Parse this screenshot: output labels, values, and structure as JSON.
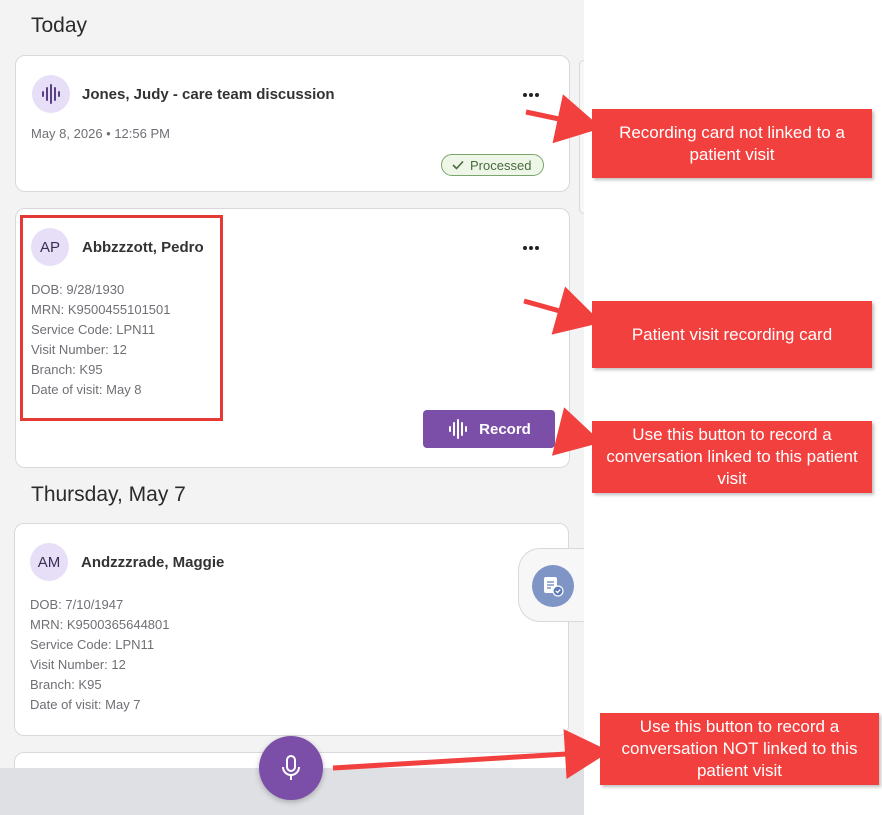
{
  "sections": {
    "today": "Today",
    "thursday": "Thursday, May 7"
  },
  "cards": {
    "recording": {
      "title": "Jones, Judy - care team discussion",
      "meta": "May 8, 2026 • 12:56 PM",
      "status": "Processed",
      "status_color": "#4a6a3d"
    },
    "visit1": {
      "initials": "AP",
      "name": "Abbzzzott, Pedro",
      "details": [
        "DOB: 9/28/1930",
        "MRN: K9500455101501",
        "Service Code: LPN11",
        "Visit Number: 12",
        "Branch: K95",
        "Date of visit: May 8"
      ],
      "record_label": "Record"
    },
    "visit2": {
      "initials": "AM",
      "name": "Andzzzrade, Maggie",
      "details": [
        "DOB: 7/10/1947",
        "MRN: K9500365644801",
        "Service Code: LPN11",
        "Visit Number: 12",
        "Branch: K95",
        "Date of visit: May 7"
      ]
    }
  },
  "callouts": {
    "not_linked": "Recording card not linked to a patient visit",
    "visit_card": "Patient visit recording card",
    "record_button": "Use this button to record a conversation linked to this patient visit",
    "mic_button": "Use this button to record a conversation NOT linked to this patient visit"
  },
  "icons": {
    "waveform": "waveform-icon",
    "more": "more-horizontal-icon",
    "check": "check-icon",
    "mic": "microphone-icon",
    "document_check": "document-check-icon"
  },
  "colors": {
    "accent_purple": "#7b4fa8",
    "callout_red": "#f2403f",
    "highlight_red": "#e53935"
  }
}
